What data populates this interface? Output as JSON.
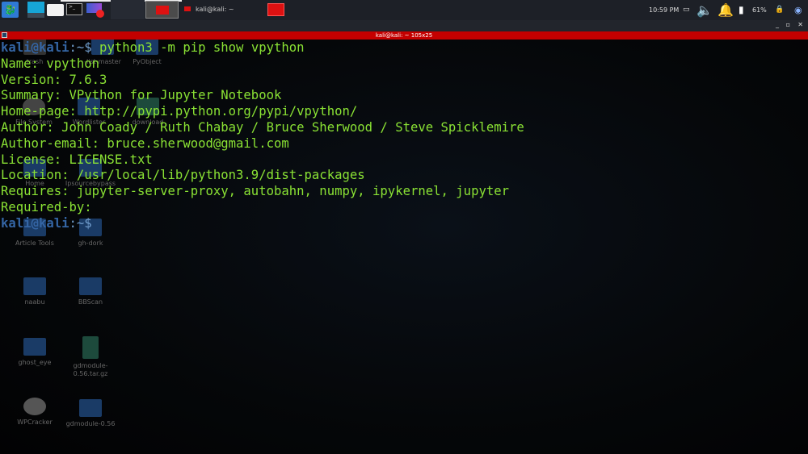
{
  "taskbar": {
    "window_task_label": "kali@kali: ~",
    "clock": "10:59 PM",
    "battery": "61%"
  },
  "window": {
    "title": "kali@kali: ~ 105x25"
  },
  "desktop_icons": [
    "trash",
    "-list-master",
    "PyObject",
    "File System",
    "Wordlister",
    "download",
    "Home",
    "Ipsourcebypass",
    "Article Tools",
    "gh-dork",
    "naabu",
    "BBScan",
    "ghost_eye",
    "gdmodule-0.56.tar.gz",
    "WPCracker",
    "gdmodule-0.56"
  ],
  "terminal": {
    "prompt_user": "kali@kali",
    "prompt_path": ":~$",
    "command": " python3 -m pip show vpython",
    "output": [
      "Name: vpython",
      "Version: 7.6.3",
      "Summary: VPython for Jupyter Notebook",
      "Home-page: http://pypi.python.org/pypi/vpython/",
      "Author: John Coady / Ruth Chabay / Bruce Sherwood / Steve Spicklemire",
      "Author-email: bruce.sherwood@gmail.com",
      "License: LICENSE.txt",
      "Location: /usr/local/lib/python3.9/dist-packages",
      "Requires: jupyter-server-proxy, autobahn, numpy, ipykernel, jupyter",
      "Required-by:"
    ]
  }
}
